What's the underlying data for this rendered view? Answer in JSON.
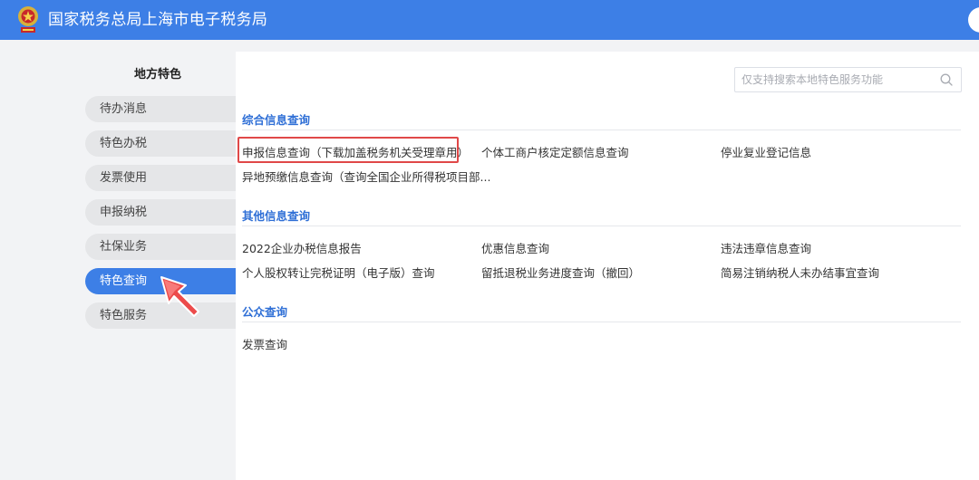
{
  "header": {
    "title": "国家税务总局上海市电子税务局",
    "emblem_icon": "tax-emblem-icon"
  },
  "sidebar": {
    "title": "地方特色",
    "items": [
      {
        "label": "待办消息",
        "active": false
      },
      {
        "label": "特色办税",
        "active": false
      },
      {
        "label": "发票使用",
        "active": false
      },
      {
        "label": "申报纳税",
        "active": false
      },
      {
        "label": "社保业务",
        "active": false
      },
      {
        "label": "特色查询",
        "active": true
      },
      {
        "label": "特色服务",
        "active": false
      }
    ]
  },
  "search": {
    "placeholder": "仅支持搜索本地特色服务功能",
    "icon": "search-icon"
  },
  "sections": [
    {
      "title": "综合信息查询",
      "links": [
        "申报信息查询（下载加盖税务机关受理章用）",
        "个体工商户核定定额信息查询",
        "停业复业登记信息",
        "异地预缴信息查询（查询全国企业所得税项目部..."
      ]
    },
    {
      "title": "其他信息查询",
      "links": [
        "2022企业办税信息报告",
        "优惠信息查询",
        "违法违章信息查询",
        "个人股权转让完税证明（电子版）查询",
        "留抵退税业务进度查询（撤回）",
        "简易注销纳税人未办结事宜查询"
      ]
    },
    {
      "title": "公众查询",
      "links": [
        "发票查询"
      ]
    }
  ],
  "colors": {
    "brand_blue": "#3d7fe6",
    "section_title": "#2f6fd6",
    "highlight_red": "#e04848",
    "pointer_red": "#ec4b4b"
  }
}
